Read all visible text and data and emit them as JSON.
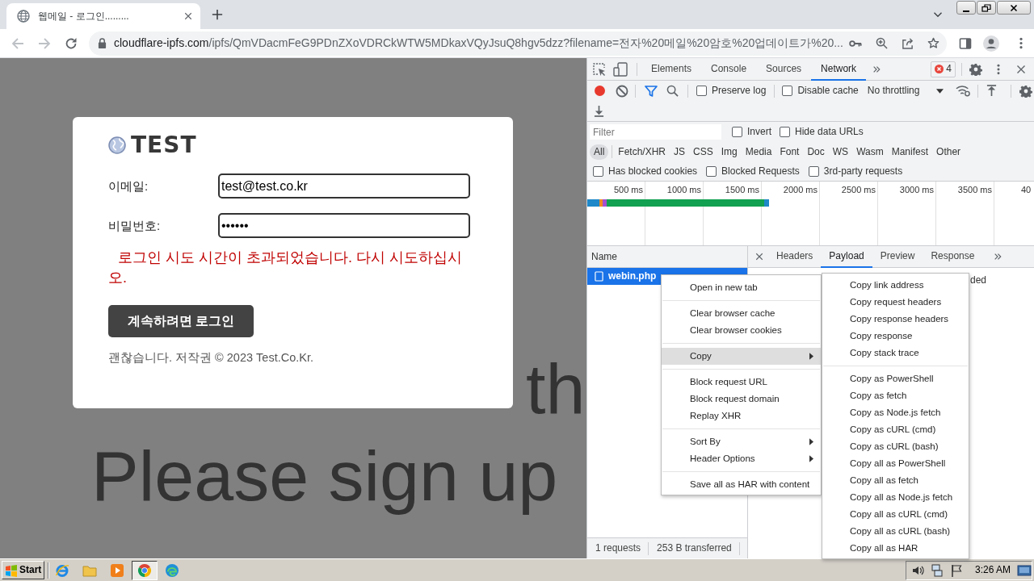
{
  "browser": {
    "tab": {
      "title": "웹메일 - 로그인.........",
      "selected": true
    },
    "nav": [
      {
        "kind": "back",
        "disabled": true
      },
      {
        "kind": "forward",
        "disabled": true
      },
      {
        "kind": "reload",
        "disabled": false
      }
    ],
    "url": {
      "host": "cloudflare-ipfs.com",
      "rest": "/ipfs/QmVDacmFeG9PDnZXoVDRCkWTW5MDkaxVQyJsuQ8hgv5dzz?filename=전자%20메일%20암호%20업데이트가%20..."
    }
  },
  "page": {
    "backdrop_text": [
      "th",
      "Please sign up"
    ],
    "login": {
      "logo": "TEST",
      "fields": [
        {
          "label": "이메일:",
          "value": "test@test.co.kr"
        },
        {
          "label": "비밀번호:",
          "value": "••••••"
        }
      ],
      "error": "로그인 시도 시간이 초과되었습니다. 다시 시도하십시오.",
      "button": "계속하려면 로그인",
      "footer": "괜찮습니다. 저작권 © 2023 Test.Co.Kr."
    }
  },
  "devtools": {
    "tabs": [
      {
        "label": "Elements",
        "selected": false
      },
      {
        "label": "Console",
        "selected": false
      },
      {
        "label": "Sources",
        "selected": false
      },
      {
        "label": "Network",
        "selected": true
      }
    ],
    "issues_count": "4",
    "recording": true,
    "toolbar_checks": [
      {
        "label": "Preserve log",
        "checked": false
      },
      {
        "label": "Disable cache",
        "checked": false
      }
    ],
    "throttling": "No throttling",
    "filter": {
      "placeholder": "Filter",
      "checks": [
        {
          "label": "Invert",
          "checked": false
        },
        {
          "label": "Hide data URLs",
          "checked": false
        }
      ]
    },
    "types": [
      {
        "label": "All",
        "selected": true
      },
      {
        "label": "Fetch/XHR",
        "selected": false
      },
      {
        "label": "JS",
        "selected": false
      },
      {
        "label": "CSS",
        "selected": false
      },
      {
        "label": "Img",
        "selected": false
      },
      {
        "label": "Media",
        "selected": false
      },
      {
        "label": "Font",
        "selected": false
      },
      {
        "label": "Doc",
        "selected": false
      },
      {
        "label": "WS",
        "selected": false
      },
      {
        "label": "Wasm",
        "selected": false
      },
      {
        "label": "Manifest",
        "selected": false
      },
      {
        "label": "Other",
        "selected": false
      }
    ],
    "blocked_checks": [
      {
        "label": "Has blocked cookies",
        "checked": false
      },
      {
        "label": "Blocked Requests",
        "checked": false
      },
      {
        "label": "3rd-party requests",
        "checked": false
      }
    ],
    "overview": {
      "ticks": [
        "500 ms",
        "1000 ms",
        "1500 ms",
        "2000 ms",
        "2500 ms",
        "3000 ms",
        "3500 ms",
        "40"
      ]
    },
    "requests": {
      "column": "Name",
      "rows": [
        {
          "name": "webin.php",
          "selected": true
        }
      ]
    },
    "detail_tabs": [
      {
        "label": "Headers",
        "selected": false
      },
      {
        "label": "Payload",
        "selected": true
      },
      {
        "label": "Preview",
        "selected": false
      },
      {
        "label": "Response",
        "selected": false
      }
    ],
    "detail_text": "ded",
    "status": [
      "1 requests",
      "253 B transferred"
    ],
    "context_menu": [
      {
        "items": [
          {
            "label": "Open in new tab",
            "selected": false,
            "submenu": false
          }
        ]
      },
      {
        "items": [
          {
            "label": "Clear browser cache",
            "selected": false,
            "submenu": false
          },
          {
            "label": "Clear browser cookies",
            "selected": false,
            "submenu": false
          }
        ]
      },
      {
        "items": [
          {
            "label": "Copy",
            "selected": true,
            "submenu": true
          }
        ]
      },
      {
        "items": [
          {
            "label": "Block request URL",
            "selected": false,
            "submenu": false
          },
          {
            "label": "Block request domain",
            "selected": false,
            "submenu": false
          },
          {
            "label": "Replay XHR",
            "selected": false,
            "submenu": false
          }
        ]
      },
      {
        "items": [
          {
            "label": "Sort By",
            "selected": false,
            "submenu": true
          },
          {
            "label": "Header Options",
            "selected": false,
            "submenu": true
          }
        ]
      },
      {
        "items": [
          {
            "label": "Save all as HAR with content",
            "selected": false,
            "submenu": false
          }
        ]
      }
    ],
    "submenu": [
      [
        "Copy link address",
        "Copy request headers",
        "Copy response headers",
        "Copy response",
        "Copy stack trace"
      ],
      [
        "Copy as PowerShell",
        "Copy as fetch",
        "Copy as Node.js fetch",
        "Copy as cURL (cmd)",
        "Copy as cURL (bash)",
        "Copy all as PowerShell",
        "Copy all as fetch",
        "Copy all as Node.js fetch",
        "Copy all as cURL (cmd)",
        "Copy all as cURL (bash)",
        "Copy all as HAR"
      ]
    ]
  },
  "taskbar": {
    "start": "Start",
    "apps": [
      {
        "kind": "ie",
        "selected": false
      },
      {
        "kind": "explorer",
        "selected": false
      },
      {
        "kind": "media",
        "selected": false
      },
      {
        "kind": "chrome",
        "selected": true
      },
      {
        "kind": "edge",
        "selected": false
      }
    ],
    "clock": "3:26 AM"
  }
}
